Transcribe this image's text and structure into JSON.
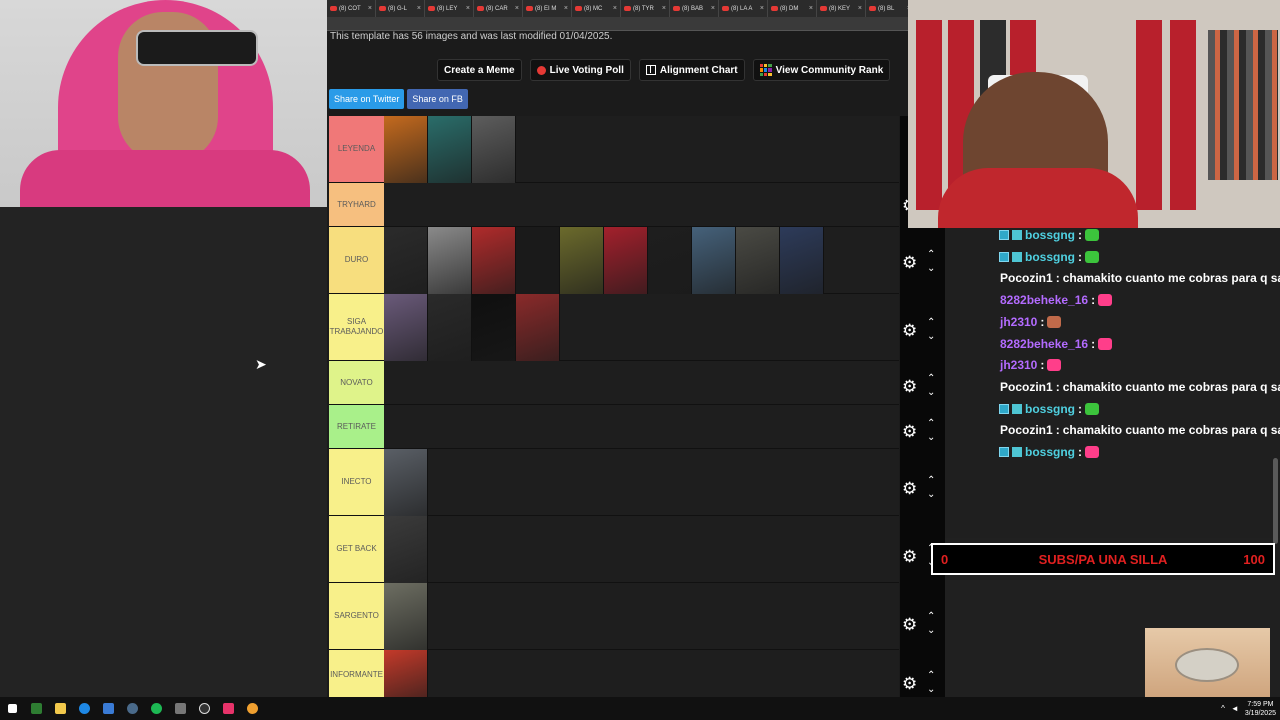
{
  "browser": {
    "tabs": [
      {
        "label": "(8) COT"
      },
      {
        "label": "(8) G-L"
      },
      {
        "label": "(8) LEY"
      },
      {
        "label": "(8) CAR"
      },
      {
        "label": "(8) EI M"
      },
      {
        "label": "(8) MC"
      },
      {
        "label": "(8) TYR"
      },
      {
        "label": "(8) BAB"
      },
      {
        "label": "(8) LA A"
      },
      {
        "label": "(8) DM"
      },
      {
        "label": "(8) KEY"
      },
      {
        "label": "(8) BL"
      }
    ],
    "tab_close": "×"
  },
  "page": {
    "template_info": "This template has 56 images and was last modified 01/04/2025.",
    "buttons": {
      "create_meme": "Create a Meme",
      "live_voting": "Live Voting Poll",
      "alignment_chart": "Alignment Chart",
      "community_rank": "View Community Rank"
    },
    "share": {
      "twitter": "Share on Twitter",
      "facebook": "Share on FB"
    }
  },
  "tiers": [
    {
      "label": "LEYENDA",
      "color": "#f07878",
      "height": 67,
      "images": [
        "#c46a1e",
        "#2a6d6a",
        "#5d5d5d"
      ]
    },
    {
      "label": "TRYHARD",
      "color": "#f6bf7f",
      "height": 44,
      "images": []
    },
    {
      "label": "DURO",
      "color": "#f7de7e",
      "height": 67,
      "images": [
        "#2b2b2b",
        "#8a8a8a",
        "#b02b2b",
        "#1a1a1a",
        "#6b6a2c",
        "#a3202c",
        "#1e1e1e",
        "#45617a",
        "#4a4a44",
        "#2d3b5a"
      ]
    },
    {
      "label": "SIGA TRABAJANDO",
      "color": "#f8f08a",
      "height": 67,
      "images": [
        "#6a5a7a",
        "#2a2a2a",
        "#0f0f0f",
        "#8a2a2a"
      ]
    },
    {
      "label": "NOVATO",
      "color": "#dff38a",
      "height": 44,
      "images": []
    },
    {
      "label": "RETIRATE",
      "color": "#a9f08a",
      "height": 44,
      "images": []
    },
    {
      "label": "INECTO",
      "color": "#f8f08a",
      "height": 67,
      "images": [
        "#5a5f66"
      ]
    },
    {
      "label": "GET BACK",
      "color": "#f8f08a",
      "height": 67,
      "images": [
        "#3b3b3b"
      ]
    },
    {
      "label": "SARGENTO",
      "color": "#f8f08a",
      "height": 67,
      "images": [
        "#6d6e62"
      ]
    },
    {
      "label": "INFORMANTE",
      "color": "#f8f08a",
      "height": 50,
      "images": [
        "#c43a2a"
      ]
    }
  ],
  "chat": [
    {
      "user": "bossgng",
      "color": "#4fd0e0",
      "badges": true,
      "text": "",
      "emote": "#3cc43c"
    },
    {
      "user": "bossgng",
      "color": "#4fd0e0",
      "badges": true,
      "text": "",
      "emote": "#3cc43c"
    },
    {
      "user": "Pocozin1",
      "color": "#ffffff",
      "badges": false,
      "text": "chamakito cuanto me cobras para q salga",
      "emote": ""
    },
    {
      "user": "8282beheke_16",
      "color": "#b36bff",
      "badges": false,
      "text": "",
      "emote": "#ff3e8a"
    },
    {
      "user": "jh2310",
      "color": "#b36bff",
      "badges": false,
      "text": "",
      "emote": "#c06a4a"
    },
    {
      "user": "8282beheke_16",
      "color": "#b36bff",
      "badges": false,
      "text": "",
      "emote": "#ff3e8a"
    },
    {
      "user": "jh2310",
      "color": "#b36bff",
      "badges": false,
      "text": "",
      "emote": "#ff3e8a"
    },
    {
      "user": "Pocozin1",
      "color": "#ffffff",
      "badges": false,
      "text": "chamakito cuanto me cobras para q salga",
      "emote": ""
    },
    {
      "user": "bossgng",
      "color": "#4fd0e0",
      "badges": true,
      "text": "",
      "emote": "#3cc43c"
    },
    {
      "user": "Pocozin1",
      "color": "#ffffff",
      "badges": false,
      "text": "chamakito cuanto me cobras para q salga",
      "emote": ""
    },
    {
      "user": "bossgng",
      "color": "#4fd0e0",
      "badges": true,
      "text": "",
      "emote": "#ff3e8a"
    }
  ],
  "subs_goal": {
    "current": "0",
    "label": "SUBS/PA UNA SILLA",
    "target": "100",
    "progress_fraction": 0
  },
  "taskbar": {
    "time": "7:59 PM",
    "date": "3/19/2025"
  },
  "colors": {
    "accent_red": "#e02020",
    "twitter_blue": "#2a9be8",
    "facebook_blue": "#4267b2"
  }
}
